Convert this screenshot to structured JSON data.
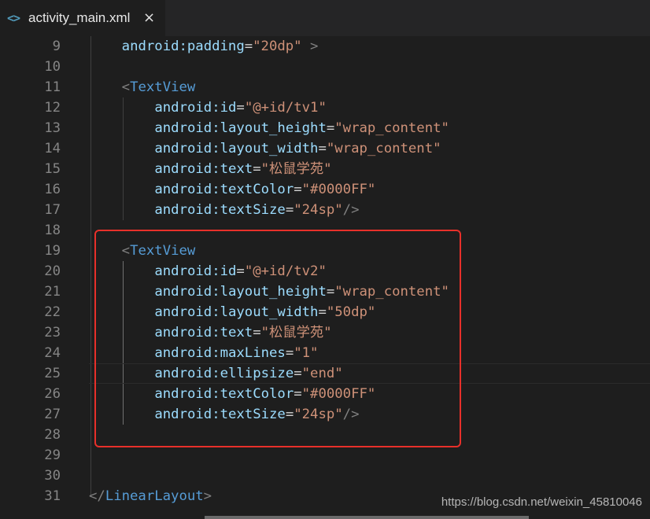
{
  "tab": {
    "icon": "xml-code-icon",
    "icon_glyph": "<>",
    "title": "activity_main.xml",
    "close_glyph": "×"
  },
  "lines": [
    {
      "n": "9",
      "indent": 1,
      "parts": [
        [
          "attr",
          "android:padding"
        ],
        [
          "eq",
          "="
        ],
        [
          "str",
          "\"20dp\""
        ],
        [
          "punct",
          " >"
        ]
      ]
    },
    {
      "n": "10",
      "indent": 0,
      "parts": []
    },
    {
      "n": "11",
      "indent": 1,
      "parts": [
        [
          "punct",
          "<"
        ],
        [
          "tag",
          "TextView"
        ]
      ]
    },
    {
      "n": "12",
      "indent": 2,
      "parts": [
        [
          "attr",
          "android:id"
        ],
        [
          "eq",
          "="
        ],
        [
          "str",
          "\"@+id/tv1\""
        ]
      ]
    },
    {
      "n": "13",
      "indent": 2,
      "parts": [
        [
          "attr",
          "android:layout_height"
        ],
        [
          "eq",
          "="
        ],
        [
          "str",
          "\"wrap_content\""
        ]
      ]
    },
    {
      "n": "14",
      "indent": 2,
      "parts": [
        [
          "attr",
          "android:layout_width"
        ],
        [
          "eq",
          "="
        ],
        [
          "str",
          "\"wrap_content\""
        ]
      ]
    },
    {
      "n": "15",
      "indent": 2,
      "parts": [
        [
          "attr",
          "android:text"
        ],
        [
          "eq",
          "="
        ],
        [
          "str",
          "\"松鼠学苑\""
        ]
      ]
    },
    {
      "n": "16",
      "indent": 2,
      "parts": [
        [
          "attr",
          "android:textColor"
        ],
        [
          "eq",
          "="
        ],
        [
          "str",
          "\"#0000FF\""
        ]
      ]
    },
    {
      "n": "17",
      "indent": 2,
      "parts": [
        [
          "attr",
          "android:textSize"
        ],
        [
          "eq",
          "="
        ],
        [
          "str",
          "\"24sp\""
        ],
        [
          "punct",
          "/>"
        ]
      ]
    },
    {
      "n": "18",
      "indent": 0,
      "parts": []
    },
    {
      "n": "19",
      "indent": 1,
      "parts": [
        [
          "punct",
          "<"
        ],
        [
          "tag",
          "TextView"
        ]
      ]
    },
    {
      "n": "20",
      "indent": 2,
      "parts": [
        [
          "attr",
          "android:id"
        ],
        [
          "eq",
          "="
        ],
        [
          "str",
          "\"@+id/tv2\""
        ]
      ]
    },
    {
      "n": "21",
      "indent": 2,
      "parts": [
        [
          "attr",
          "android:layout_height"
        ],
        [
          "eq",
          "="
        ],
        [
          "str",
          "\"wrap_content\""
        ]
      ]
    },
    {
      "n": "22",
      "indent": 2,
      "parts": [
        [
          "attr",
          "android:layout_width"
        ],
        [
          "eq",
          "="
        ],
        [
          "str",
          "\"50dp\""
        ]
      ]
    },
    {
      "n": "23",
      "indent": 2,
      "parts": [
        [
          "attr",
          "android:text"
        ],
        [
          "eq",
          "="
        ],
        [
          "str",
          "\"松鼠学苑\""
        ]
      ]
    },
    {
      "n": "24",
      "indent": 2,
      "parts": [
        [
          "attr",
          "android:maxLines"
        ],
        [
          "eq",
          "="
        ],
        [
          "str",
          "\"1\""
        ]
      ]
    },
    {
      "n": "25",
      "indent": 2,
      "parts": [
        [
          "attr",
          "android:ellipsize"
        ],
        [
          "eq",
          "="
        ],
        [
          "str",
          "\"end\""
        ]
      ]
    },
    {
      "n": "26",
      "indent": 2,
      "parts": [
        [
          "attr",
          "android:textColor"
        ],
        [
          "eq",
          "="
        ],
        [
          "str",
          "\"#0000FF\""
        ]
      ]
    },
    {
      "n": "27",
      "indent": 2,
      "parts": [
        [
          "attr",
          "android:textSize"
        ],
        [
          "eq",
          "="
        ],
        [
          "str",
          "\"24sp\""
        ],
        [
          "punct",
          "/>"
        ]
      ]
    },
    {
      "n": "28",
      "indent": 0,
      "parts": []
    },
    {
      "n": "29",
      "indent": 0,
      "parts": []
    },
    {
      "n": "30",
      "indent": 0,
      "parts": []
    },
    {
      "n": "31",
      "indent": 0,
      "parts": [
        [
          "punct",
          "</"
        ],
        [
          "tag",
          "LinearLayout"
        ],
        [
          "punct",
          ">"
        ]
      ]
    }
  ],
  "colors": {
    "background": "#1e1e1e",
    "attribute": "#9cdcfe",
    "string": "#ce9178",
    "tag": "#569cd6",
    "punctuation": "#808080",
    "line_number": "#858585",
    "highlight_box": "#e8302a"
  },
  "watermark": "https://blog.csdn.net/weixin_45810046"
}
